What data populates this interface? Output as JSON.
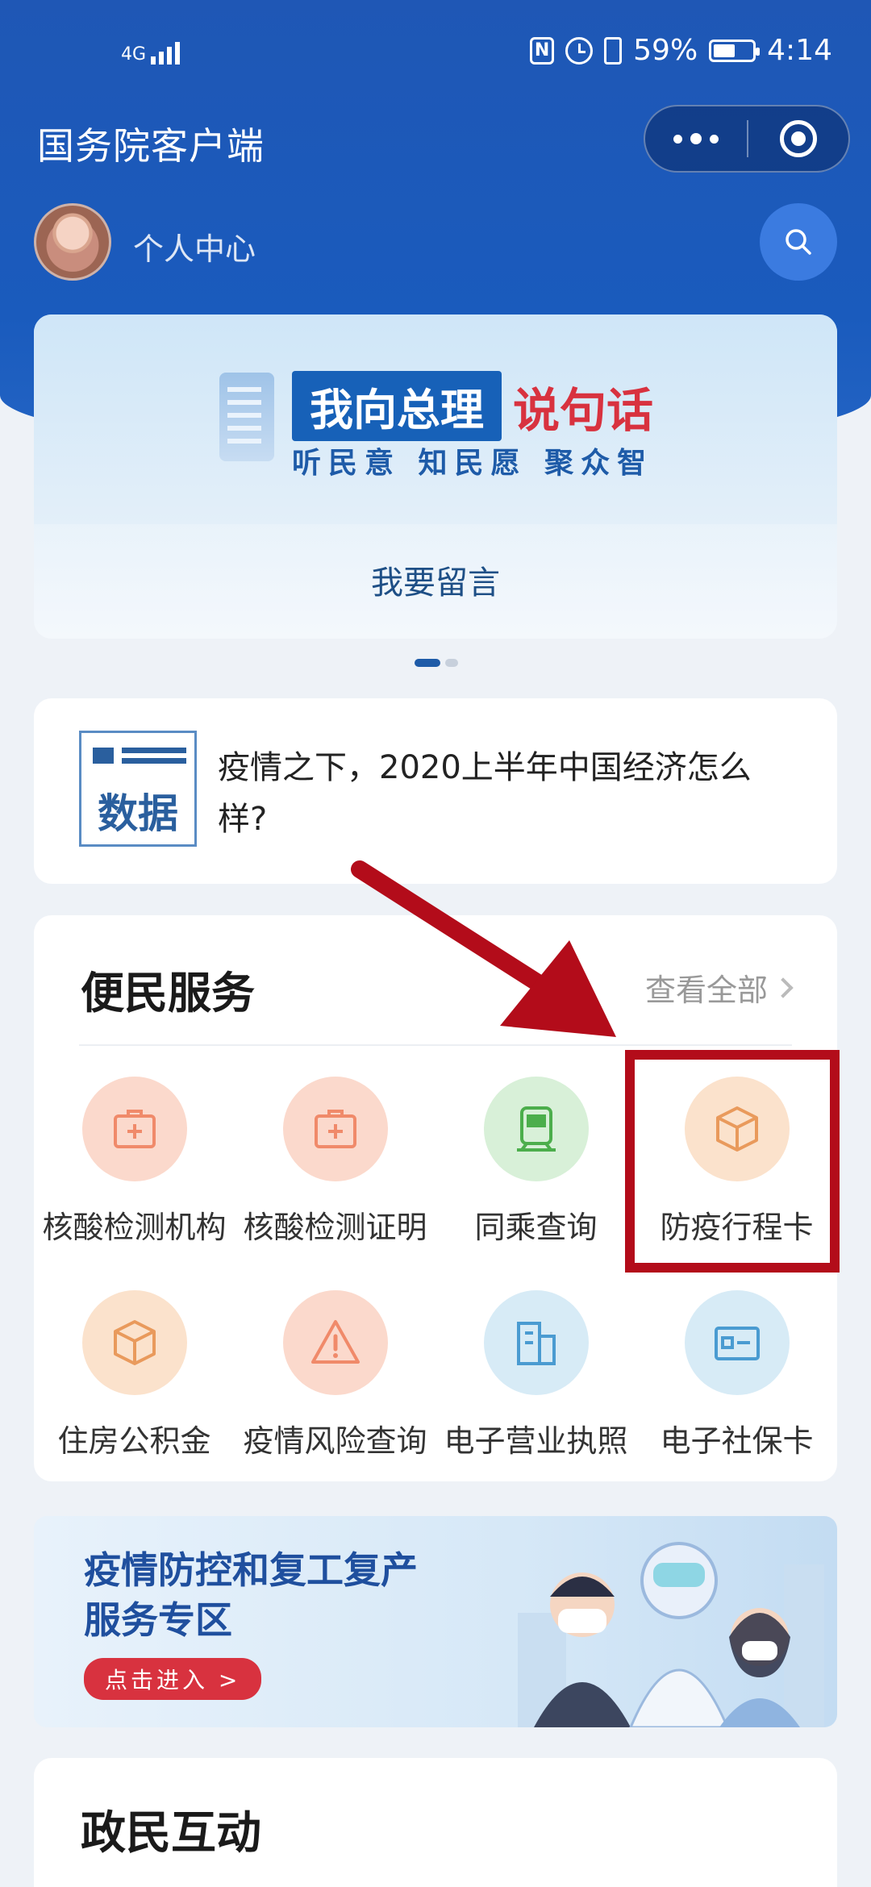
{
  "status_bar": {
    "network": "4G",
    "battery_percent": "59%",
    "time": "4:14"
  },
  "app": {
    "title": "国务院客户端"
  },
  "user": {
    "label": "个人中心"
  },
  "banner": {
    "tag": "我向总理",
    "headline_red": "说句话",
    "subtitle": "听民意 知民愿 聚众智",
    "action": "我要留言",
    "pager": {
      "current": 1,
      "total": 2
    }
  },
  "news": {
    "icon_text": "数据",
    "headline": "疫情之下，2020上半年中国经济怎么样?"
  },
  "services": {
    "title": "便民服务",
    "view_all": "查看全部",
    "items": [
      {
        "label": "核酸检测机构",
        "icon": "medical-kit-icon",
        "color": "#f08a6a"
      },
      {
        "label": "核酸检测证明",
        "icon": "medical-kit-icon",
        "color": "#f08a6a"
      },
      {
        "label": "同乘查询",
        "icon": "train-icon",
        "color": "#4cae4c"
      },
      {
        "label": "防疫行程卡",
        "icon": "box-icon",
        "color": "#e99a5c"
      },
      {
        "label": "住房公积金",
        "icon": "box-icon",
        "color": "#e99a5c"
      },
      {
        "label": "疫情风险查询",
        "icon": "warning-icon",
        "color": "#f08a6a"
      },
      {
        "label": "电子营业执照",
        "icon": "building-icon",
        "color": "#4a9bd1"
      },
      {
        "label": "电子社保卡",
        "icon": "id-card-icon",
        "color": "#4a9bd1"
      }
    ]
  },
  "promo": {
    "line1": "疫情防控和复工复产",
    "line2": "服务专区",
    "button": "点击进入 >"
  },
  "interaction": {
    "title": "政民互动"
  },
  "colors": {
    "header_blue": "#1f57b5",
    "highlight_red": "#b30c1a",
    "accent_red": "#d8323f"
  }
}
